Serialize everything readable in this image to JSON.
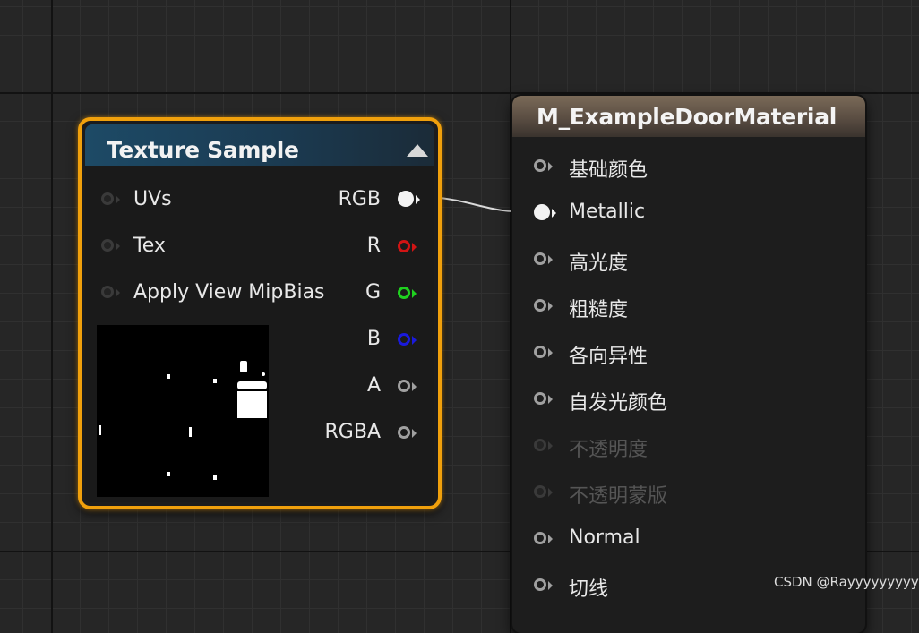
{
  "texture_node": {
    "title": "Texture Sample",
    "inputs": [
      {
        "label": "UVs"
      },
      {
        "label": "Tex"
      },
      {
        "label": "Apply View MipBias"
      }
    ],
    "outputs": [
      {
        "label": "RGB"
      },
      {
        "label": "R"
      },
      {
        "label": "G"
      },
      {
        "label": "B"
      },
      {
        "label": "A"
      },
      {
        "label": "RGBA"
      }
    ]
  },
  "material_node": {
    "title": "M_ExampleDoorMaterial",
    "inputs": [
      {
        "label": "基础颜色",
        "enabled": true
      },
      {
        "label": "Metallic",
        "enabled": true
      },
      {
        "label": "高光度",
        "enabled": true
      },
      {
        "label": "粗糙度",
        "enabled": true
      },
      {
        "label": "各向异性",
        "enabled": true
      },
      {
        "label": "自发光颜色",
        "enabled": true
      },
      {
        "label": "不透明度",
        "enabled": false
      },
      {
        "label": "不透明蒙版",
        "enabled": false
      },
      {
        "label": "Normal",
        "enabled": true
      },
      {
        "label": "切线",
        "enabled": true
      }
    ]
  },
  "colors": {
    "selection_outline": "#f0a00c",
    "texture_header": "#1d4a66",
    "material_header": "#6a5b4c",
    "pin_r": "#d11414",
    "pin_g": "#1fd11f",
    "pin_b": "#1a1adc"
  },
  "watermark": "CSDN @Rayyyyyyyyy"
}
